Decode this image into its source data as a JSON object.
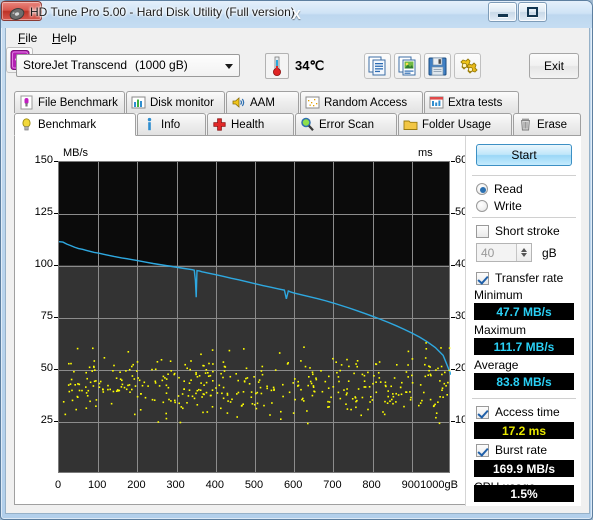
{
  "window": {
    "title": "HD Tune Pro 5.00 - Hard Disk Utility (Full version)",
    "icon": "hdtune-disk-icon",
    "minimize_label": "Minimize",
    "maximize_label": "Maximize",
    "close_label": "X"
  },
  "menu": {
    "file": "File",
    "help": "Help"
  },
  "toolbar": {
    "drive_name": "StoreJet Transcend",
    "drive_capacity": "(1000 gB)",
    "temperature": "34℃",
    "temperature_icon": "thermometer-icon",
    "copy_text_icon": "copy-text-icon",
    "copy_image_icon": "copy-image-icon",
    "save_icon": "save-icon",
    "settings_icon": "settings-icon",
    "update_icon": "download-arrow-icon",
    "exit_label": "Exit"
  },
  "tabs_row1": [
    {
      "label": "File Benchmark",
      "icon": "file-benchmark-icon",
      "active": false
    },
    {
      "label": "Disk monitor",
      "icon": "disk-monitor-icon",
      "active": false
    },
    {
      "label": "AAM",
      "icon": "speaker-icon",
      "active": false
    },
    {
      "label": "Random Access",
      "icon": "random-access-icon",
      "active": false
    },
    {
      "label": "Extra tests",
      "icon": "extra-tests-icon",
      "active": false
    }
  ],
  "tabs_row2": [
    {
      "label": "Benchmark",
      "icon": "benchmark-bulb-icon",
      "active": true
    },
    {
      "label": "Info",
      "icon": "info-icon",
      "active": false
    },
    {
      "label": "Health",
      "icon": "health-cross-icon",
      "active": false
    },
    {
      "label": "Error Scan",
      "icon": "magnifier-icon",
      "active": false
    },
    {
      "label": "Folder Usage",
      "icon": "folder-icon",
      "active": false
    },
    {
      "label": "Erase",
      "icon": "trash-icon",
      "active": false
    }
  ],
  "results": {
    "start_label": "Start",
    "read_label": "Read",
    "write_label": "Write",
    "read_selected": true,
    "write_selected": false,
    "short_stroke_label": "Short stroke",
    "short_stroke_checked": false,
    "short_stroke_value": "40",
    "short_stroke_unit": "gB",
    "transfer_rate_label": "Transfer rate",
    "transfer_rate_checked": true,
    "minimum_label": "Minimum",
    "minimum_value": "47.7 MB/s",
    "maximum_label": "Maximum",
    "maximum_value": "111.7 MB/s",
    "average_label": "Average",
    "average_value": "83.8 MB/s",
    "access_time_label": "Access time",
    "access_time_checked": true,
    "access_time_value": "17.2 ms",
    "burst_rate_label": "Burst rate",
    "burst_rate_checked": true,
    "burst_rate_value": "169.9 MB/s",
    "cpu_usage_label": "CPU usage",
    "cpu_usage_value": "1.5%"
  },
  "colors": {
    "transfer_line": "#2ea8e0",
    "access_dots": "#ffff00",
    "plot_background": "#333333",
    "plot_background_top": "#0b0b0b",
    "grid": "#8c8c8c",
    "lcd_cyan": "#2ad0f5",
    "lcd_yellow": "#e8e800",
    "close_button": "#bc3225"
  },
  "chart_data": {
    "type": "line",
    "title": "",
    "xlabel": "gB",
    "ylabel": "MB/s",
    "y2label": "ms",
    "xlim": [
      0,
      1000
    ],
    "ylim": [
      0,
      150
    ],
    "y2lim": [
      0,
      60
    ],
    "xticks": [
      0,
      100,
      200,
      300,
      400,
      500,
      600,
      700,
      800,
      900,
      1000
    ],
    "xtick_labels": [
      "0",
      "100",
      "200",
      "300",
      "400",
      "500",
      "600",
      "700",
      "800",
      "900",
      "1000gB"
    ],
    "yticks": [
      25,
      50,
      75,
      100,
      125,
      150
    ],
    "ytick_labels": [
      "25",
      "50",
      "75",
      "100",
      "125",
      "150"
    ],
    "y2ticks": [
      10,
      20,
      30,
      40,
      50,
      60
    ],
    "y2tick_labels": [
      "10",
      "20",
      "30",
      "40",
      "50",
      "60"
    ],
    "grid": true,
    "series": [
      {
        "name": "Transfer rate",
        "type": "line",
        "color": "#2ea8e0",
        "axis": "left",
        "unit": "MB/s",
        "x": [
          0,
          10,
          20,
          30,
          40,
          50,
          60,
          70,
          80,
          90,
          100,
          120,
          140,
          160,
          180,
          200,
          220,
          240,
          260,
          280,
          300,
          320,
          330,
          340,
          345,
          348,
          350,
          352,
          355,
          358,
          360,
          365,
          370,
          380,
          400,
          420,
          440,
          460,
          480,
          500,
          520,
          540,
          560,
          575,
          580,
          585,
          590,
          595,
          600,
          620,
          640,
          660,
          680,
          700,
          720,
          740,
          760,
          780,
          800,
          820,
          840,
          860,
          880,
          900,
          920,
          940,
          960,
          980,
          1000
        ],
        "y": [
          111.7,
          111.5,
          110.5,
          109.8,
          109.0,
          108.4,
          108.0,
          107.5,
          107.0,
          106.5,
          106.2,
          105.4,
          104.6,
          103.9,
          103.3,
          102.6,
          101.9,
          101.2,
          100.6,
          100.0,
          99.4,
          98.8,
          98.5,
          98.2,
          98.0,
          93.0,
          85.0,
          97.8,
          97.7,
          97.6,
          97.5,
          97.2,
          97.0,
          96.6,
          95.8,
          95.0,
          94.1,
          93.3,
          92.4,
          91.5,
          90.6,
          89.8,
          89.0,
          88.4,
          84.2,
          88.0,
          87.6,
          87.3,
          87.0,
          86.1,
          85.2,
          84.3,
          83.3,
          82.2,
          81.0,
          79.8,
          78.5,
          77.2,
          75.8,
          74.4,
          72.9,
          71.3,
          69.6,
          67.8,
          65.8,
          63.5,
          60.8,
          57.0,
          47.7
        ]
      },
      {
        "name": "Access time",
        "type": "scatter",
        "color": "#ffff00",
        "axis": "right",
        "unit": "ms",
        "point_count": 420,
        "mean_ms": 17.2,
        "spread_ms": [
          4,
          26
        ],
        "x_range": [
          0,
          1000
        ],
        "description": "Yellow scatter of random-access seek times spread across the whole LBA range, clustering around 10-22 ms (shown on left-scale 25-55 MB/s band)."
      }
    ],
    "summary": {
      "minimum_MBps": 47.7,
      "maximum_MBps": 111.7,
      "average_MBps": 83.8,
      "access_time_ms": 17.2,
      "burst_rate_MBps": 169.9,
      "cpu_usage_percent": 1.5
    }
  }
}
